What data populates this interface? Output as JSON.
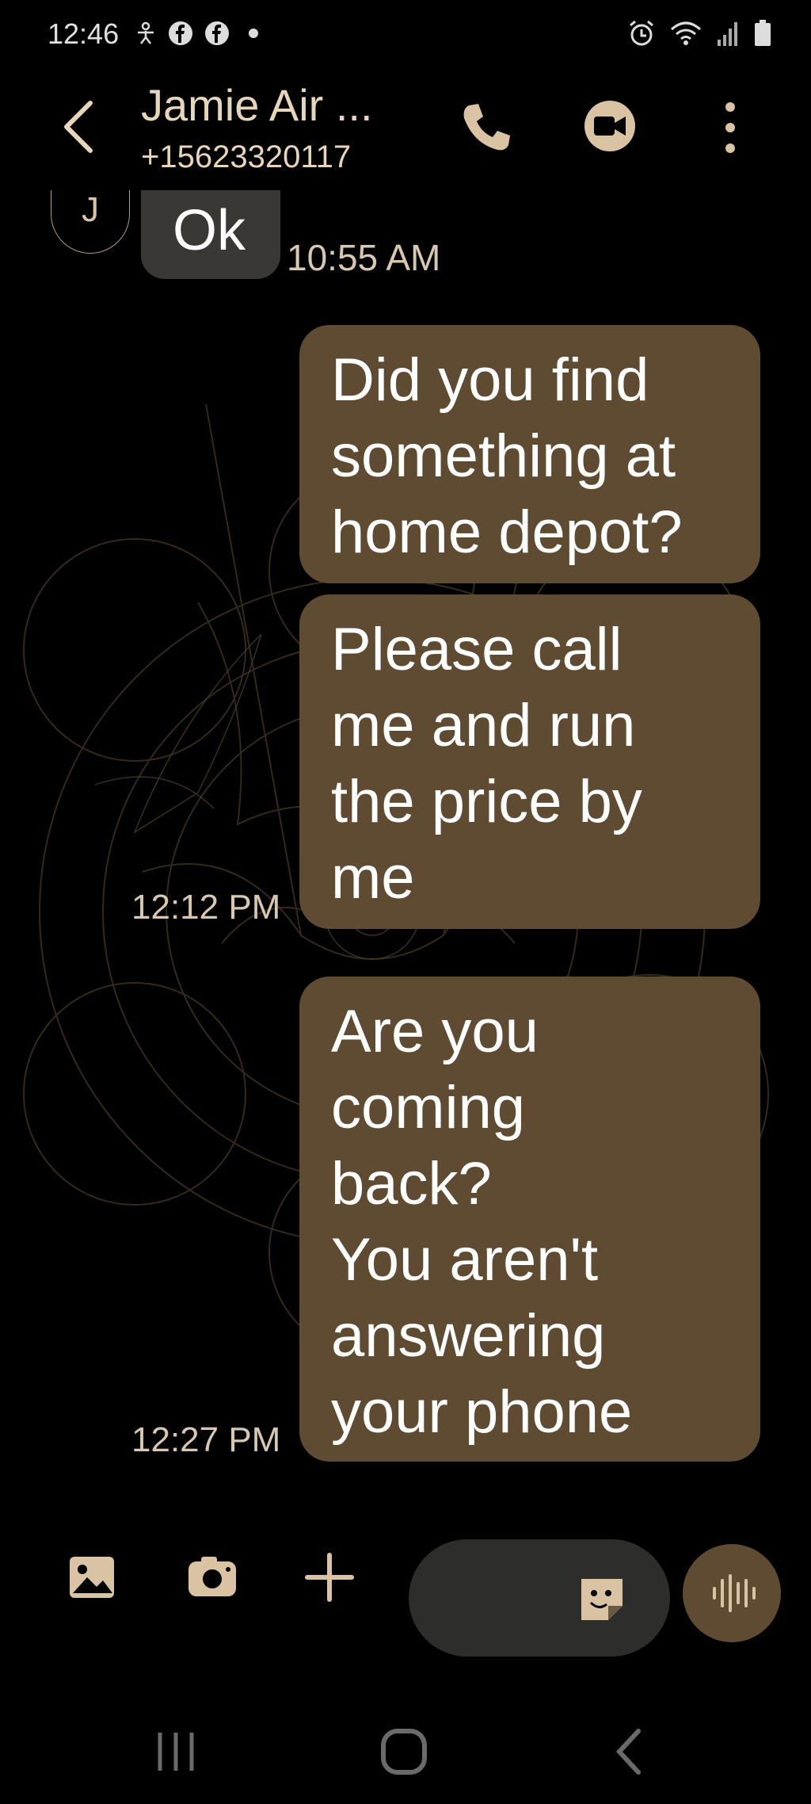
{
  "status_bar": {
    "time": "12:46",
    "left_icons": [
      "accessibility-icon",
      "facebook-icon",
      "facebook-icon",
      "dot-icon"
    ],
    "right_icons": [
      "alarm-icon",
      "wifi-icon",
      "signal-icon",
      "battery-icon"
    ]
  },
  "header": {
    "contact_name": "Jamie Air ...",
    "contact_number": "+15623320117"
  },
  "conversation": {
    "avatar_initial": "J",
    "incoming": {
      "text": "Ok",
      "time": "10:55 AM"
    },
    "outgoing": [
      {
        "text": "Did you find\nsomething at\nhome depot?"
      },
      {
        "text": "Please call\nme and run\nthe price by\nme",
        "time": "12:12 PM"
      },
      {
        "text": "Are you\ncoming\nback?\nYou aren't\nanswering\nyour phone",
        "time": "12:27 PM"
      }
    ]
  },
  "composer": {
    "placeholder": ""
  },
  "colors": {
    "accent": "#5e4b31",
    "icon": "#dac3a2",
    "background": "#000000"
  }
}
